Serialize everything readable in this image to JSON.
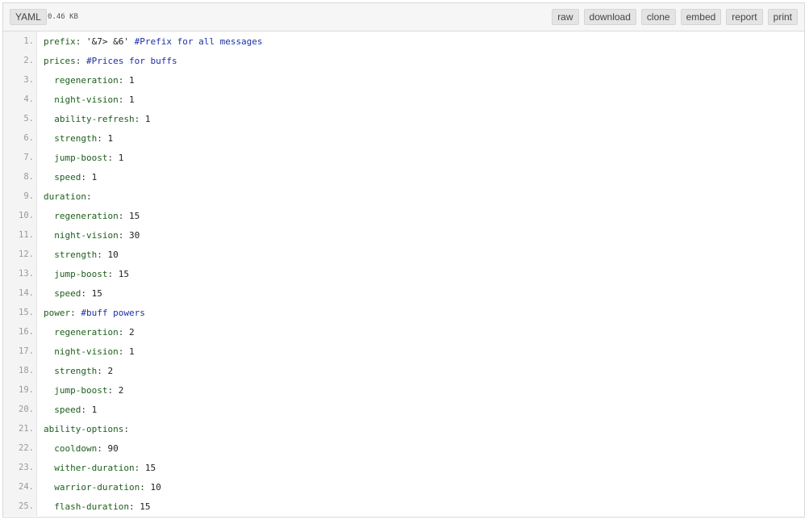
{
  "header": {
    "language": "YAML",
    "size": "0.46 KB",
    "actions": [
      "raw",
      "download",
      "clone",
      "embed",
      "report",
      "print"
    ]
  },
  "lines": [
    {
      "num": "1.",
      "indent": "",
      "key": "prefix",
      "value": " '&7> &6' ",
      "comment": "#Prefix for all messages"
    },
    {
      "num": "2.",
      "indent": "",
      "key": "prices",
      "value": " ",
      "comment": "#Prices for buffs"
    },
    {
      "num": "3.",
      "indent": "  ",
      "key": "regeneration",
      "value": " 1",
      "comment": ""
    },
    {
      "num": "4.",
      "indent": "  ",
      "key": "night-vision",
      "value": " 1",
      "comment": ""
    },
    {
      "num": "5.",
      "indent": "  ",
      "key": "ability-refresh",
      "value": " 1",
      "comment": ""
    },
    {
      "num": "6.",
      "indent": "  ",
      "key": "strength",
      "value": " 1",
      "comment": ""
    },
    {
      "num": "7.",
      "indent": "  ",
      "key": "jump-boost",
      "value": " 1",
      "comment": ""
    },
    {
      "num": "8.",
      "indent": "  ",
      "key": "speed",
      "value": " 1",
      "comment": ""
    },
    {
      "num": "9.",
      "indent": "",
      "key": "duration",
      "value": "",
      "comment": ""
    },
    {
      "num": "10.",
      "indent": "  ",
      "key": "regeneration",
      "value": " 15",
      "comment": ""
    },
    {
      "num": "11.",
      "indent": "  ",
      "key": "night-vision",
      "value": " 30",
      "comment": ""
    },
    {
      "num": "12.",
      "indent": "  ",
      "key": "strength",
      "value": " 10",
      "comment": ""
    },
    {
      "num": "13.",
      "indent": "  ",
      "key": "jump-boost",
      "value": " 15",
      "comment": ""
    },
    {
      "num": "14.",
      "indent": "  ",
      "key": "speed",
      "value": " 15",
      "comment": ""
    },
    {
      "num": "15.",
      "indent": "",
      "key": "power",
      "value": " ",
      "comment": "#buff powers"
    },
    {
      "num": "16.",
      "indent": "  ",
      "key": "regeneration",
      "value": " 2",
      "comment": ""
    },
    {
      "num": "17.",
      "indent": "  ",
      "key": "night-vision",
      "value": " 1",
      "comment": ""
    },
    {
      "num": "18.",
      "indent": "  ",
      "key": "strength",
      "value": " 2",
      "comment": ""
    },
    {
      "num": "19.",
      "indent": "  ",
      "key": "jump-boost",
      "value": " 2",
      "comment": ""
    },
    {
      "num": "20.",
      "indent": "  ",
      "key": "speed",
      "value": " 1",
      "comment": ""
    },
    {
      "num": "21.",
      "indent": "",
      "key": "ability-options",
      "value": "",
      "comment": ""
    },
    {
      "num": "22.",
      "indent": "  ",
      "key": "cooldown",
      "value": " 90",
      "comment": ""
    },
    {
      "num": "23.",
      "indent": "  ",
      "key": "wither-duration",
      "value": " 15",
      "comment": ""
    },
    {
      "num": "24.",
      "indent": "  ",
      "key": "warrior-duration",
      "value": " 10",
      "comment": ""
    },
    {
      "num": "25.",
      "indent": "  ",
      "key": "flash-duration",
      "value": " 15",
      "comment": ""
    }
  ]
}
